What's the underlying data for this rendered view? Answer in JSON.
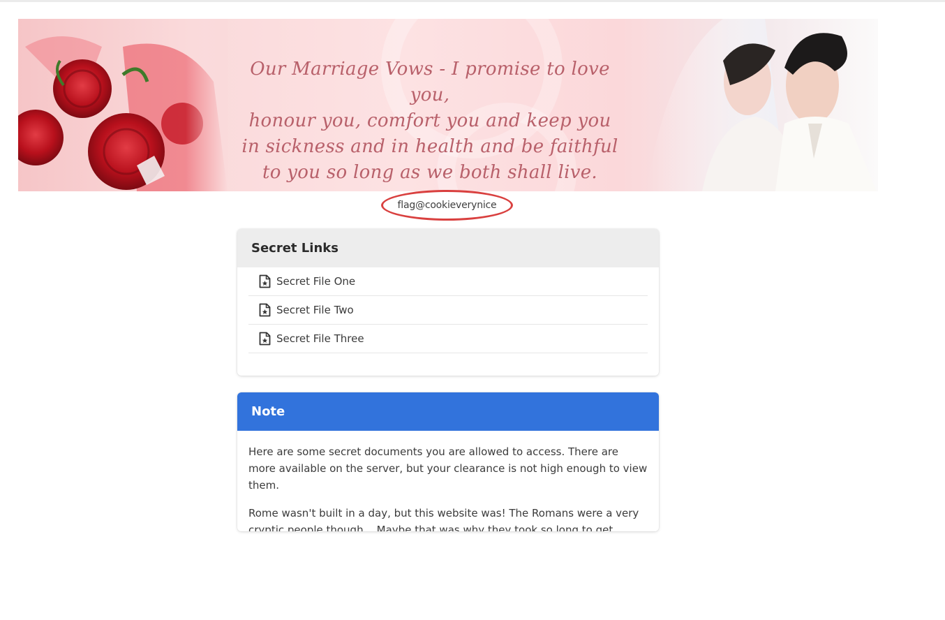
{
  "banner": {
    "vow_lines": [
      "Our Marriage Vows - I promise to love you,",
      "honour you, comfort you and keep you",
      "in sickness and in health and be faithful",
      "to you so long as we both shall live."
    ]
  },
  "flag_text": "flag@cookieverynice",
  "secret_links": {
    "title": "Secret Links",
    "items": [
      {
        "label": "Secret File One",
        "icon": "file-star-icon"
      },
      {
        "label": "Secret File Two",
        "icon": "file-star-icon"
      },
      {
        "label": "Secret File Three",
        "icon": "file-star-icon"
      }
    ]
  },
  "note": {
    "title": "Note",
    "paragraphs": [
      "Here are some secret documents you are allowed to access. There are more available on the server, but your clearance is not high enough to view them.",
      "Rome wasn't built in a day, but this website was! The Romans were a very cryptic people though... Maybe that was why they took so long to get things done."
    ],
    "accent_color": "#3273dc"
  },
  "colors": {
    "annotation_ring": "#d9403f",
    "header_gray": "#ededed"
  }
}
